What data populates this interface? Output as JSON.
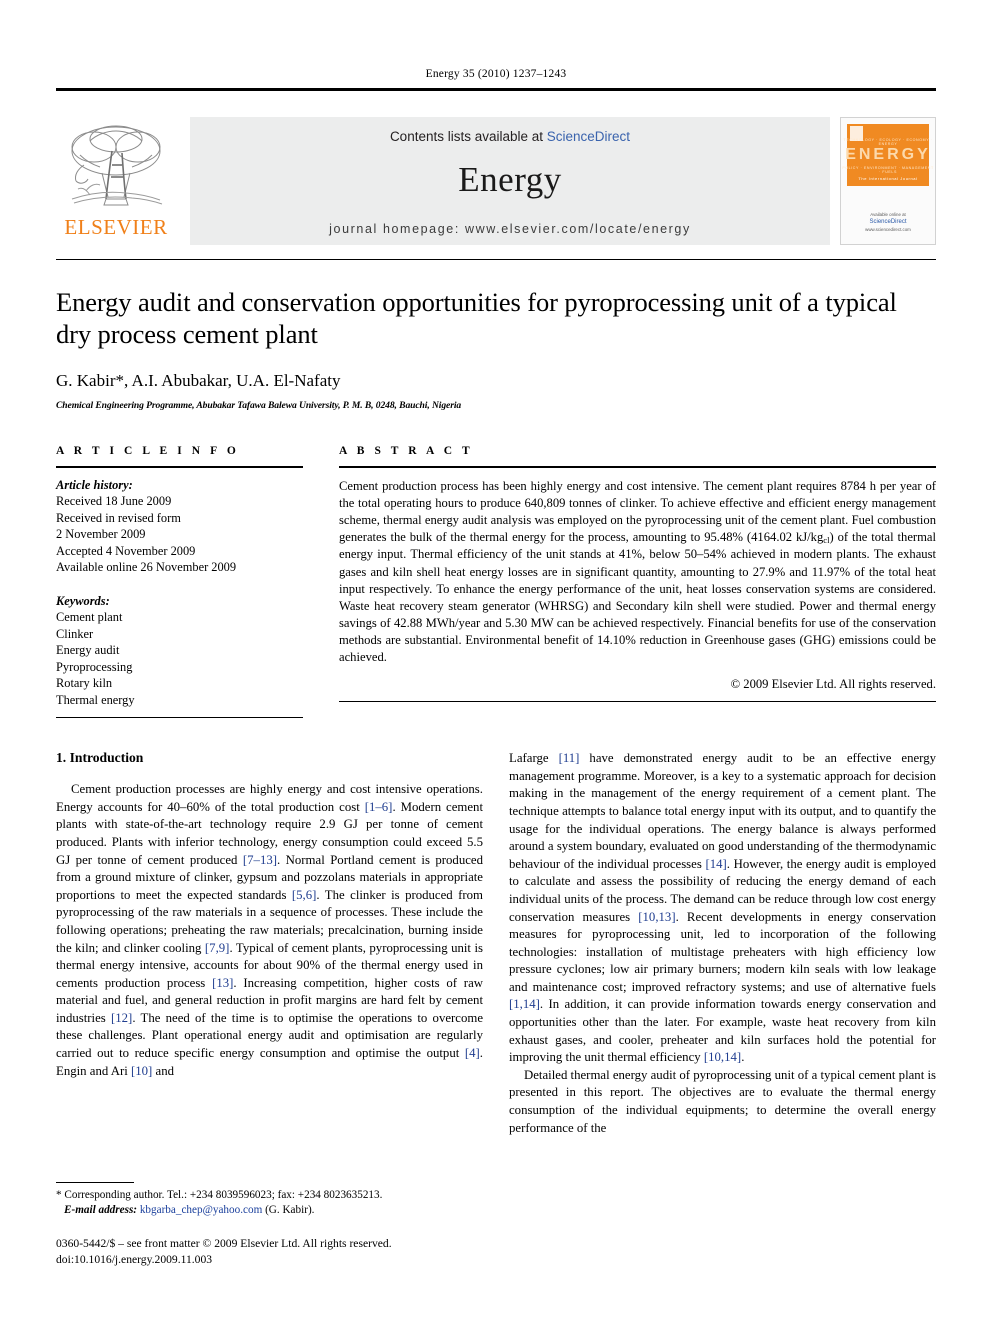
{
  "running_head": "Energy 35 (2010) 1237–1243",
  "masthead": {
    "publisher_logo_text": "ELSEVIER",
    "contents_prefix": "Contents lists available at ",
    "contents_link": "ScienceDirect",
    "journal_name": "Energy",
    "homepage_line": "journal homepage: www.elsevier.com/locate/energy",
    "cover": {
      "title": "ENERGY",
      "subtitle": "The International Journal",
      "row_top": "TECHNOLOGY   ·   ECOLOGY   ·   ECONOMY   ·   ENERGY",
      "row_bottom": "POLICY   ·   ENVIRONMENT   ·   MANAGEMENT   ·   FUELS",
      "available_at": "Available online at",
      "sciencedirect": "ScienceDirect",
      "url": "www.sciencedirect.com"
    }
  },
  "article": {
    "title": "Energy audit and conservation opportunities for pyroprocessing unit of a typical dry process cement plant",
    "authors": "G. Kabir*, A.I. Abubakar, U.A. El-Nafaty",
    "affiliation": "Chemical Engineering Programme, Abubakar Tafawa Balewa University, P. M. B, 0248, Bauchi, Nigeria"
  },
  "article_info": {
    "heading": "A R T I C L E   I N F O",
    "history_label": "Article history:",
    "history": [
      "Received 18 June 2009",
      "Received in revised form",
      "2 November 2009",
      "Accepted 4 November 2009",
      "Available online 26 November 2009"
    ],
    "keywords_label": "Keywords:",
    "keywords": [
      "Cement plant",
      "Clinker",
      "Energy audit",
      "Pyroprocessing",
      "Rotary kiln",
      "Thermal energy"
    ]
  },
  "abstract": {
    "heading": "A B S T R A C T",
    "part1": "Cement production process has been highly energy and cost intensive. The cement plant requires 8784 h per year of the total operating hours to produce 640,809 tonnes of clinker. To achieve effective and efficient energy management scheme, thermal energy audit analysis was employed on the pyroprocessing unit of the cement plant. Fuel combustion generates the bulk of the thermal energy for the process, amounting to 95.48% (4164.02 kJ/kg",
    "subscript": "cl",
    "part2": ") of the total thermal energy input. Thermal efficiency of the unit stands at 41%, below 50–54% achieved in modern plants. The exhaust gases and kiln shell heat energy losses are in significant quantity, amounting to 27.9% and 11.97% of the total heat input respectively. To enhance the energy performance of the unit, heat losses conservation systems are considered. Waste heat recovery steam generator (WHRSG) and Secondary kiln shell were studied. Power and thermal energy savings of 42.88 MWh/year and 5.30 MW can be achieved respectively. Financial benefits for use of the conservation methods are substantial. Environmental benefit of 14.10% reduction in Greenhouse gases (GHG) emissions could be achieved.",
    "copyright": "© 2009 Elsevier Ltd. All rights reserved."
  },
  "introduction": {
    "section_title": "1.  Introduction",
    "left": {
      "p1_a": "Cement production processes are highly energy and cost intensive operations. Energy accounts for 40–60% of the total production cost ",
      "p1_r1": "[1–6]",
      "p1_b": ". Modern cement plants with state-of-the-art technology require 2.9 GJ per tonne of cement produced. Plants with inferior technology, energy consumption could exceed 5.5 GJ per tonne of cement produced ",
      "p1_r2": "[7–13]",
      "p1_c": ". Normal Portland cement is produced from a ground mixture of clinker, gypsum and pozzolans materials in appropriate proportions to meet the expected standards ",
      "p1_r3": "[5,6]",
      "p1_d": ". The clinker is produced from pyroprocessing of the raw materials in a sequence of processes. These include the following operations; preheating the raw materials; precalcination, burning inside the kiln; and clinker cooling ",
      "p1_r4": "[7,9]",
      "p1_e": ". Typical of cement plants, pyroprocessing unit is thermal energy intensive, accounts for about 90% of the thermal energy used in cements production process ",
      "p1_r5": "[13]",
      "p1_f": ". Increasing competition, higher costs of raw material and fuel, and general reduction in profit margins are hard felt by cement industries ",
      "p1_r6": "[12]",
      "p1_g": ". The need of the time is to optimise the operations to overcome these challenges. Plant operational energy audit and optimisation are regularly carried out to reduce specific energy consumption and optimise the output ",
      "p1_r7": "[4]",
      "p1_h": ". Engin and Ari ",
      "p1_r8": "[10]",
      "p1_i": " and"
    },
    "right": {
      "p1_a": "Lafarge ",
      "p1_r1": "[11]",
      "p1_b": " have demonstrated energy audit to be an effective energy management programme. Moreover, is a key to a systematic approach for decision making in the management of the energy requirement of a cement plant. The technique attempts to balance total energy input with its output, and to quantify the usage for the individual operations. The energy balance is always performed around a system boundary, evaluated on good understanding of the thermodynamic behaviour of the individual processes ",
      "p1_r2": "[14]",
      "p1_c": ". However, the energy audit is employed to calculate and assess the possibility of reducing the energy demand of each individual units of the process. The demand can be reduce through low cost energy conservation measures ",
      "p1_r3": "[10,13]",
      "p1_d": ". Recent developments in energy conservation measures for pyroprocessing unit, led to incorporation of the following technologies: installation of multistage preheaters with high efficiency low pressure cyclones; low air primary burners; modern kiln seals with low leakage and maintenance cost; improved refractory systems; and use of alternative fuels ",
      "p1_r4": "[1,14]",
      "p1_e": ". In addition, it can provide information towards energy conservation and opportunities other than the later. For example, waste heat recovery from kiln exhaust gases, and cooler, preheater and kiln surfaces hold the potential for improving the unit thermal efficiency ",
      "p1_r5": "[10,14]",
      "p1_f": ".",
      "p2": "Detailed thermal energy audit of pyroprocessing unit of a typical cement plant is presented in this report. The objectives are to evaluate the thermal energy consumption of the individual equipments; to determine the overall energy performance of the"
    }
  },
  "footnotes": {
    "corresponding_marker": "*",
    "corresponding": " Corresponding author. Tel.: +234 8039596023; fax: +234 8023635213.",
    "email_label": "E-mail address:",
    "email": "kbgarba_chep@yahoo.com",
    "email_suffix": " (G. Kabir).",
    "imprint_line1": "0360-5442/$ – see front matter © 2009 Elsevier Ltd. All rights reserved.",
    "imprint_line2": "doi:10.1016/j.energy.2009.11.003"
  },
  "colors": {
    "link_blue": "#3a63ad",
    "reference_blue": "#1f3d8f",
    "elsevier_orange": "#f08019",
    "banner_grey": "#eceded"
  }
}
